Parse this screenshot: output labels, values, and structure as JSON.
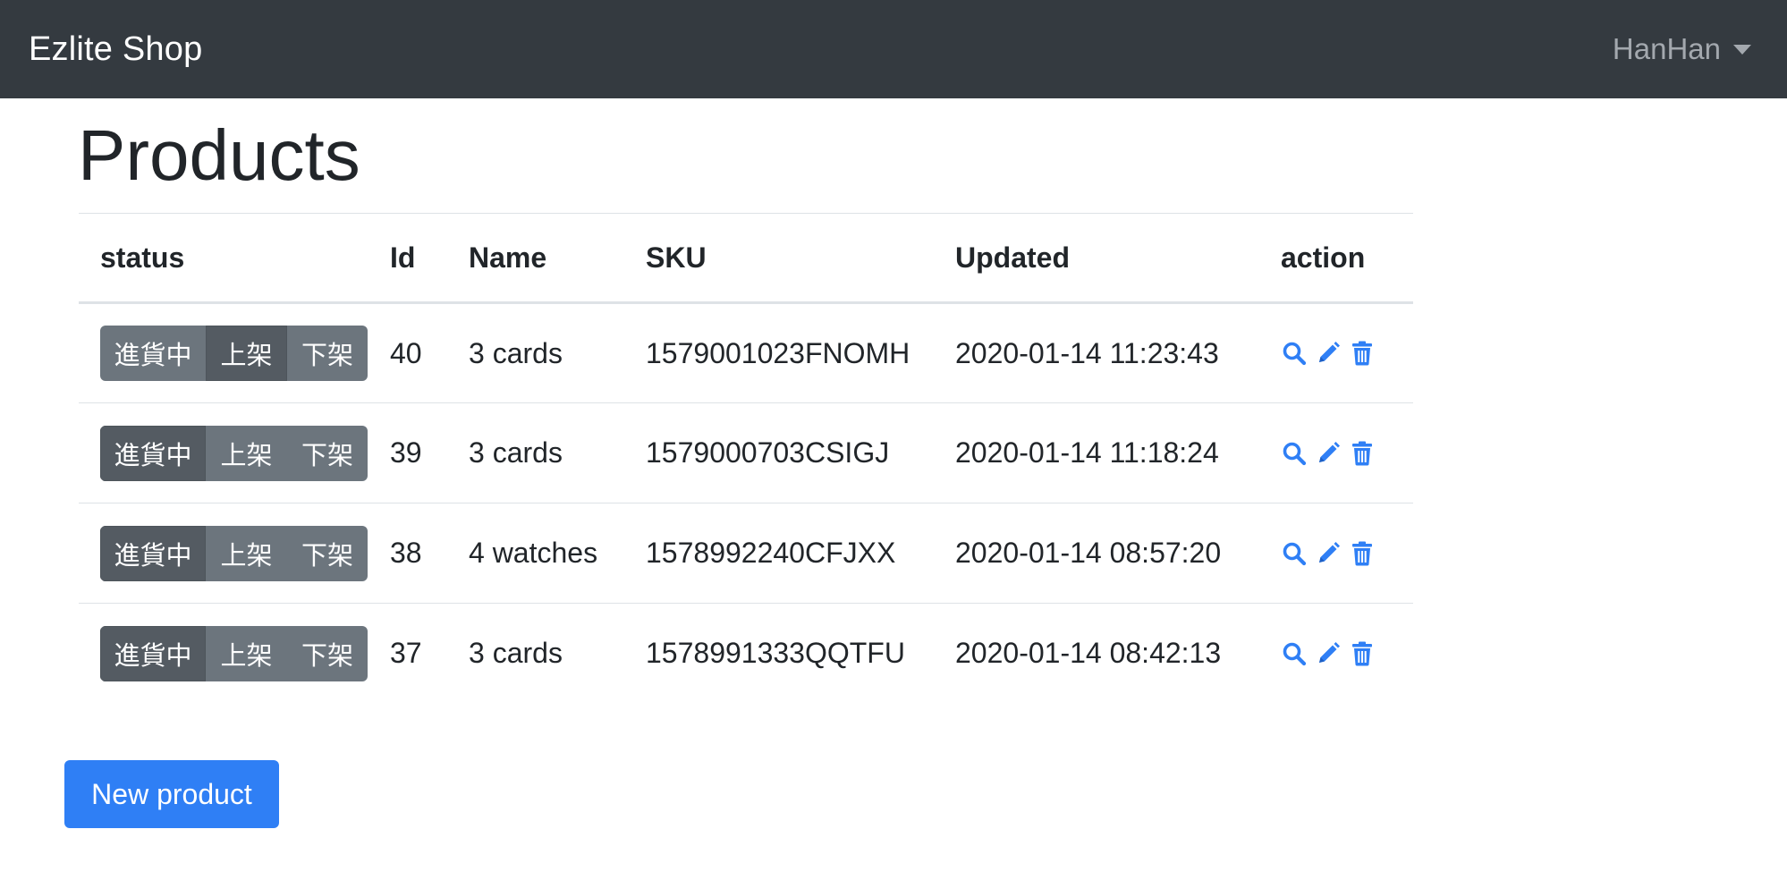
{
  "navbar": {
    "brand": "Ezlite Shop",
    "user": "HanHan"
  },
  "page": {
    "title": "Products"
  },
  "table": {
    "headers": {
      "status": "status",
      "id": "Id",
      "name": "Name",
      "sku": "SKU",
      "updated": "Updated",
      "action": "action"
    },
    "status_options": [
      "進貨中",
      "上架",
      "下架"
    ],
    "rows": [
      {
        "status_active": 1,
        "id": "40",
        "name": "3 cards",
        "sku": "1579001023FNOMH",
        "updated": "2020-01-14 11:23:43"
      },
      {
        "status_active": 0,
        "id": "39",
        "name": "3 cards",
        "sku": "1579000703CSIGJ",
        "updated": "2020-01-14 11:18:24"
      },
      {
        "status_active": 0,
        "id": "38",
        "name": "4 watches",
        "sku": "1578992240CFJXX",
        "updated": "2020-01-14 08:57:20"
      },
      {
        "status_active": 0,
        "id": "37",
        "name": "3 cards",
        "sku": "1578991333QQTFU",
        "updated": "2020-01-14 08:42:13"
      }
    ],
    "action_icons": [
      "search-icon",
      "pencil-icon",
      "trash-icon"
    ]
  },
  "footer": {
    "new_product_label": "New product"
  },
  "colors": {
    "navbar": "#343a40",
    "primary": "#2f7ff5",
    "secondary": "#6c757d",
    "secondary_active": "#545b62",
    "link_icon": "#2f7ff5"
  }
}
